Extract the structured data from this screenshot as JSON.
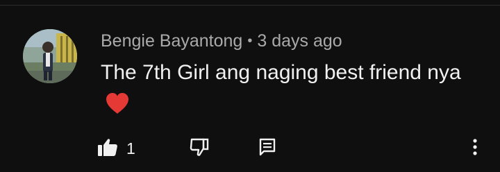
{
  "comment": {
    "author": "Bengie Bayantong",
    "separator": "•",
    "timestamp": "3 days ago",
    "text": "The 7th Girl ang naging best friend nya",
    "emoji": "❤"
  },
  "actions": {
    "like_count": "1",
    "like_icon": "thumbs-up-icon",
    "dislike_icon": "thumbs-down-icon",
    "reply_icon": "comment-reply-icon",
    "more_icon": "more-vertical-icon"
  },
  "colors": {
    "background": "#0f0f0f",
    "author": "#aaaaaa",
    "text": "#f1f1f1",
    "heart": "#e53935"
  }
}
